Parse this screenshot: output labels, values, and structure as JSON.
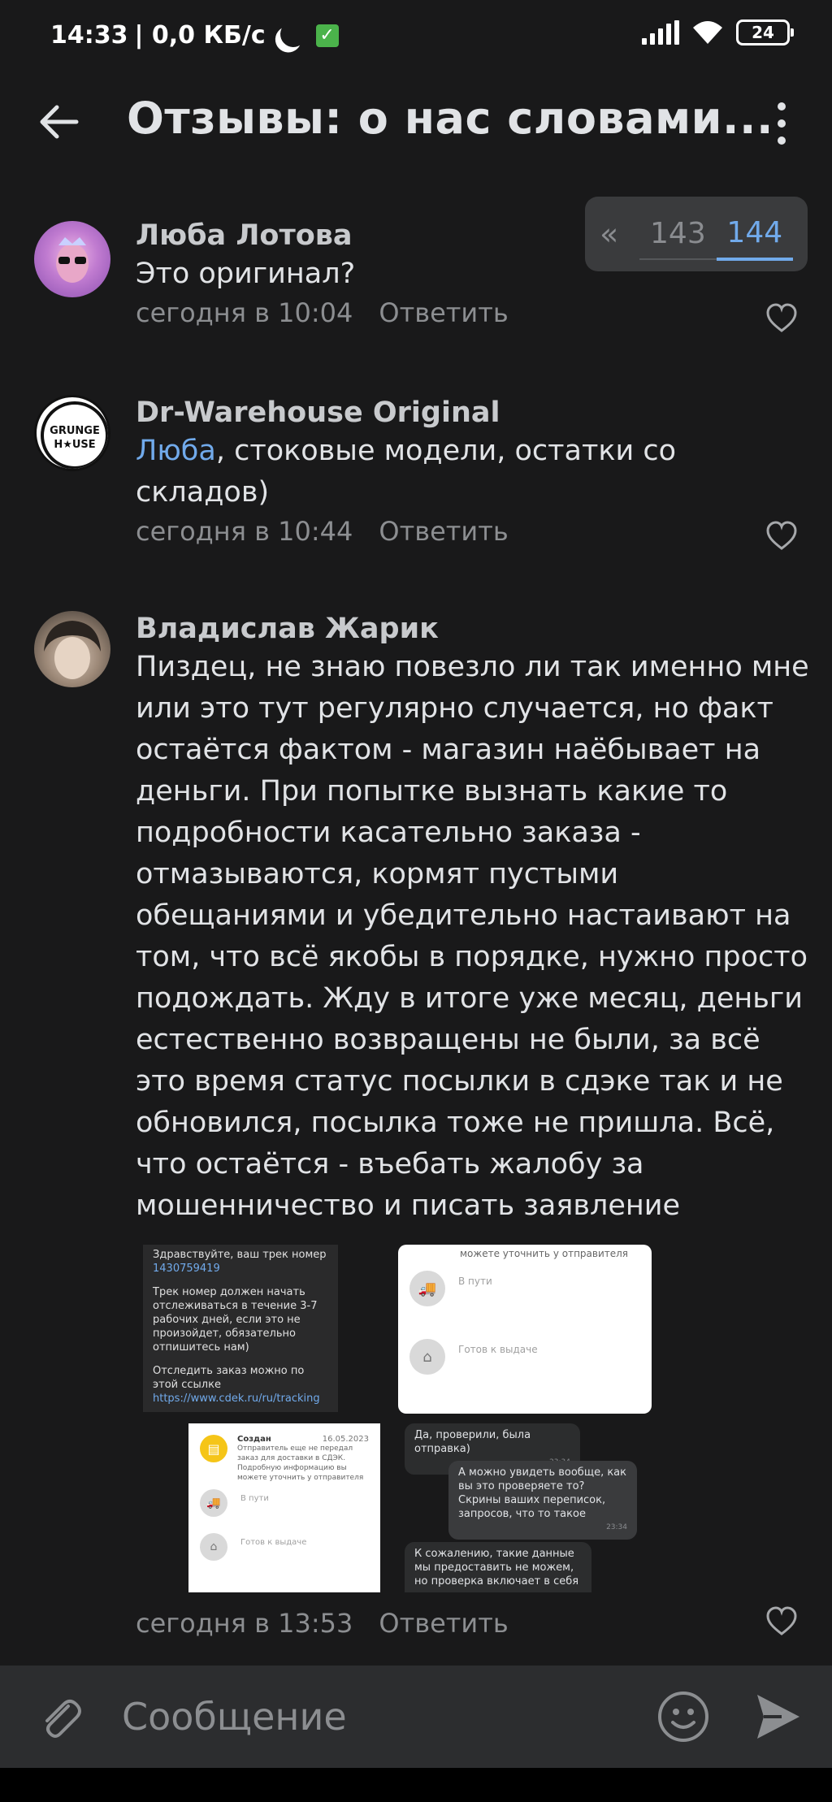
{
  "status_bar": {
    "time": "14:33",
    "speed": "| 0,0 КБ/с",
    "battery": "24"
  },
  "header": {
    "title": "Отзывы: о нас словами..."
  },
  "pagination": {
    "prev": "«",
    "pages": [
      "143",
      "144"
    ],
    "active_page": "144"
  },
  "comments": [
    {
      "author": "Люба Лотова",
      "text": "Это оригинал?",
      "time": "сегодня в 10:04",
      "reply": "Ответить"
    },
    {
      "author": "Dr-Warehouse Original",
      "mention": "Люба",
      "text": ", стоковые модели, остатки со складов)",
      "time": "сегодня в 10:44",
      "reply": "Ответить",
      "avatar_text": "GRUNGE HOUSE"
    },
    {
      "author": "Владислав Жарик",
      "text": "Пиздец, не знаю повезло ли так именно мне или это тут регулярно случается, но факт остаётся фактом - магазин наёбывает на деньги. При попытке вызнать какие то подробности касательно заказа - отмазываются, кормят пустыми обещаниями и убедительно настаивают на том, что всё якобы в порядке, нужно просто подождать. Жду в итоге уже месяц, деньги естественно возвращены не были, за всё это время статус посылки в сдэке так и не обновился, посылка  тоже не пришла. Всё, что остаётся - въебать жалобу за мошенничество и писать заявление",
      "time": "сегодня в 13:53",
      "reply": "Ответить"
    }
  ],
  "attachments": {
    "a1": {
      "line1": "Здравствуйте, ваш трек номер",
      "track": "1430759419",
      "line2": "Трек номер должен начать отслеживаться в течение 3-7 рабочих дней, если это не произойдет, обязательно отпишитесь нам)",
      "line3": "Отследить заказ можно по этой ссылке",
      "link": "https://www.cdek.ru/ru/tracking"
    },
    "a2": {
      "top": "можете уточнить у отправителя",
      "step1": "В пути",
      "step2": "Готов к выдаче"
    },
    "a3": {
      "title": "Создан",
      "date": "16.05.2023",
      "desc": "Отправитель еще не передал заказ для доставки в СДЭК. Подробную информацию вы можете уточнить у отправителя",
      "step1": "В пути",
      "step2": "Готов к выдаче"
    },
    "chat": {
      "b1": "Да, проверили, была отправка)",
      "b1_time": "23:34",
      "b2": "А можно увидеть вообще, как вы это проверяете то? Скрины ваших переписок, запросов, что то такое",
      "b2_time": "23:34",
      "b3": "К сожалению, такие данные мы предоставить не можем, но проверка включает в себя"
    }
  },
  "composer": {
    "placeholder": "Сообщение"
  },
  "colors": {
    "background": "#19191a",
    "accent": "#71aaeb",
    "secondary_text": "#8c8e91"
  }
}
